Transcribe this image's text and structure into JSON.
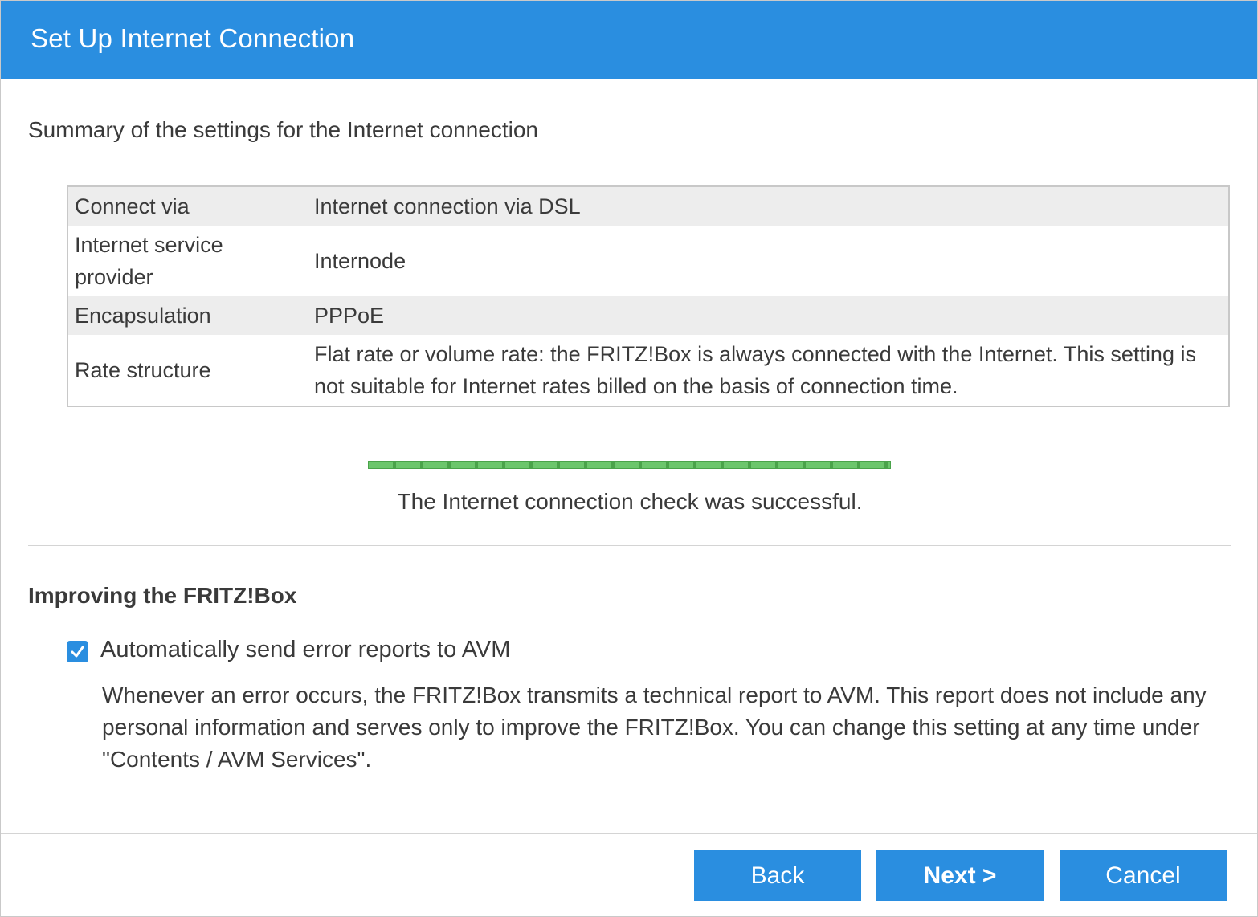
{
  "window": {
    "title": "Set Up Internet Connection",
    "accent_color": "#2a8ee0"
  },
  "summary": {
    "heading": "Summary of the settings for the Internet connection",
    "rows": [
      {
        "key": "Connect via",
        "value": "Internet connection via DSL"
      },
      {
        "key": "Internet service provider",
        "value": "Internode"
      },
      {
        "key": "Encapsulation",
        "value": "PPPoE"
      },
      {
        "key": "Rate structure",
        "value": "Flat rate or volume rate: the FRITZ!Box is always connected with the Internet. This setting is not suitable for Internet rates billed on the basis of connection time."
      }
    ]
  },
  "connection_check": {
    "progress_fraction": 1.0,
    "progress_color": "#5cb85c",
    "status_text": "The Internet connection check was successful."
  },
  "improve": {
    "heading": "Improving the FRITZ!Box",
    "checkbox_checked": true,
    "checkbox_label": "Automatically send error reports to AVM",
    "explanation": "Whenever an error occurs, the FRITZ!Box transmits a technical report to AVM. This report does not include any personal information and serves only to improve the FRITZ!Box. You can change this setting at any time under \"Contents / AVM Services\"."
  },
  "buttons": {
    "back_label": "Back",
    "next_label": "Next >",
    "cancel_label": "Cancel"
  }
}
